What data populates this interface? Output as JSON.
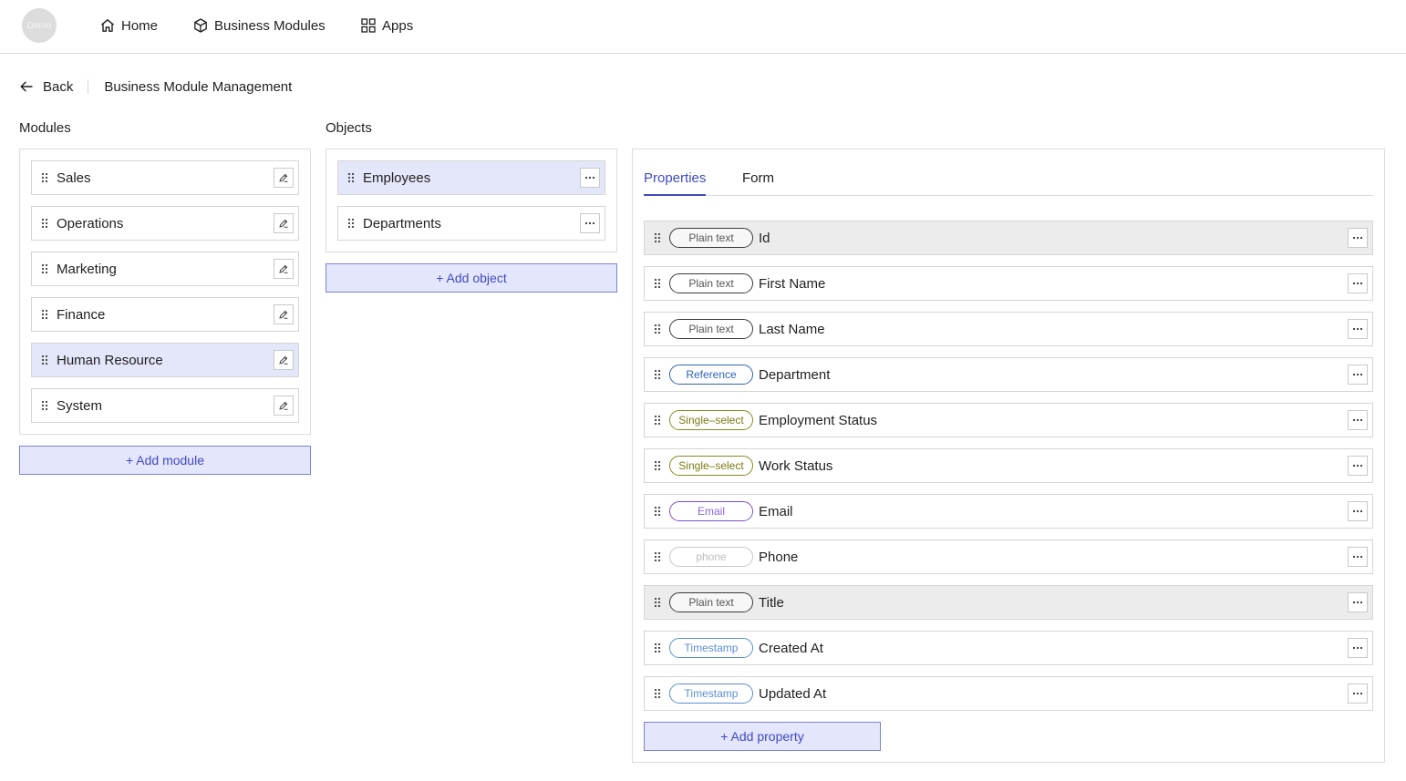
{
  "nav": {
    "logo_text": "Demo",
    "items": [
      {
        "label": "Home",
        "icon": "home-icon"
      },
      {
        "label": "Business Modules",
        "icon": "cube-icon"
      },
      {
        "label": "Apps",
        "icon": "apps-grid-icon"
      }
    ]
  },
  "breadcrumb": {
    "back_label": "Back",
    "title": "Business Module Management"
  },
  "modules": {
    "heading": "Modules",
    "items": [
      {
        "label": "Sales",
        "selected": false
      },
      {
        "label": "Operations",
        "selected": false
      },
      {
        "label": "Marketing",
        "selected": false
      },
      {
        "label": "Finance",
        "selected": false
      },
      {
        "label": "Human Resource",
        "selected": true
      },
      {
        "label": "System",
        "selected": false
      }
    ],
    "add_label": "+ Add module"
  },
  "objects": {
    "heading": "Objects",
    "items": [
      {
        "label": "Employees",
        "selected": true
      },
      {
        "label": "Departments",
        "selected": false
      }
    ],
    "add_label": "+ Add object"
  },
  "detail": {
    "tabs": [
      {
        "label": "Properties",
        "active": true
      },
      {
        "label": "Form",
        "active": false
      }
    ],
    "properties": [
      {
        "type": "Plain text",
        "name": "Id",
        "highlighted": true
      },
      {
        "type": "Plain text",
        "name": "First Name",
        "highlighted": false
      },
      {
        "type": "Plain text",
        "name": "Last Name",
        "highlighted": false
      },
      {
        "type": "Reference",
        "name": "Department",
        "highlighted": false
      },
      {
        "type": "Single–select",
        "name": "Employment Status",
        "highlighted": false
      },
      {
        "type": "Single–select",
        "name": "Work Status",
        "highlighted": false
      },
      {
        "type": "Email",
        "name": "Email",
        "highlighted": false
      },
      {
        "type": "phone",
        "name": "Phone",
        "highlighted": false
      },
      {
        "type": "Plain text",
        "name": "Title",
        "highlighted": true
      },
      {
        "type": "Timestamp",
        "name": "Created At",
        "highlighted": false
      },
      {
        "type": "Timestamp",
        "name": "Updated At",
        "highlighted": false
      }
    ],
    "add_label": "+ Add property"
  },
  "tag_colors": {
    "Plain text": {
      "border": "#3a3a3a",
      "text": "#555555"
    },
    "Reference": {
      "border": "#2f63b8",
      "text": "#2f63b8"
    },
    "Single–select": {
      "border": "#8a8a1e",
      "text": "#7a7a10"
    },
    "Email": {
      "border": "#7a4fd0",
      "text": "#8a65d8"
    },
    "phone": {
      "border": "#c7c7c7",
      "text": "#bdbdbd"
    },
    "Timestamp": {
      "border": "#5b8ed6",
      "text": "#5b8ed6"
    }
  },
  "colors": {
    "accent": "#3f4ac2",
    "selected_row": "#e4e6f9",
    "highlighted_row": "#ececec"
  }
}
